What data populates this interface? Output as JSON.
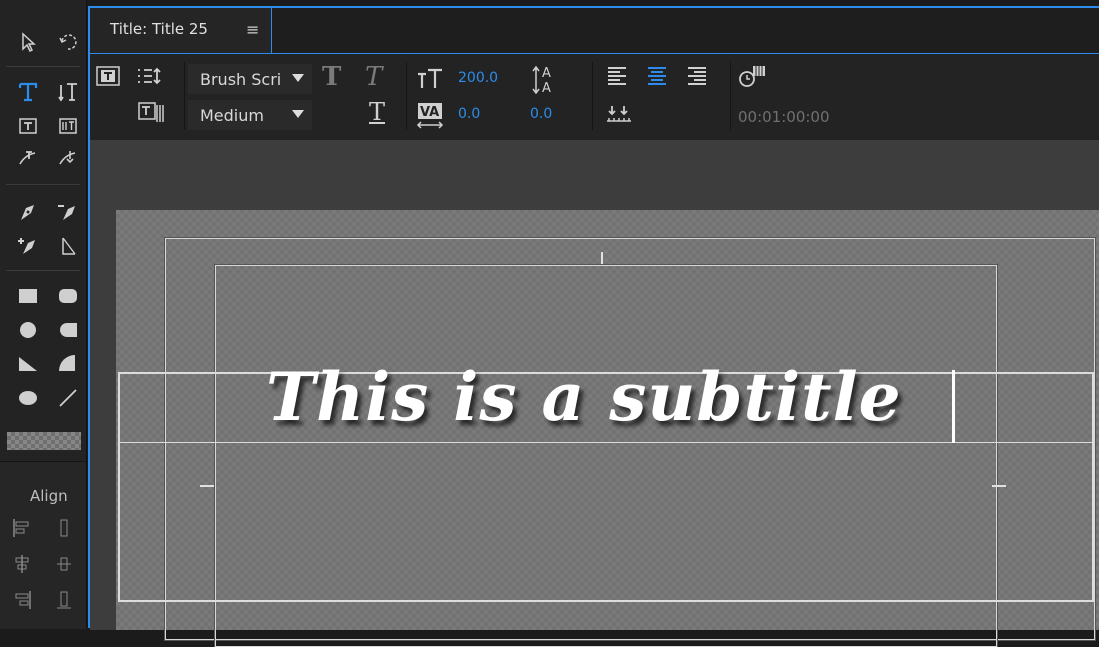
{
  "tab": {
    "title": "Title: Title 25",
    "menu_glyph": "≡"
  },
  "toolbar": {
    "font_family": "Brush Scri",
    "font_style": "Medium",
    "bold_glyph": "T",
    "italic_glyph": "T",
    "underline_glyph": "T",
    "font_size": "200.0",
    "kerning": "0.0",
    "leading": "0.0",
    "timecode": "00:01:00:00"
  },
  "tools": {
    "align_label": "Align"
  },
  "canvas": {
    "subtitle_text": "This is a subtitle"
  },
  "colors": {
    "accent": "#2d8ceb",
    "panel": "#252525",
    "canvas": "#7a7a7a"
  }
}
